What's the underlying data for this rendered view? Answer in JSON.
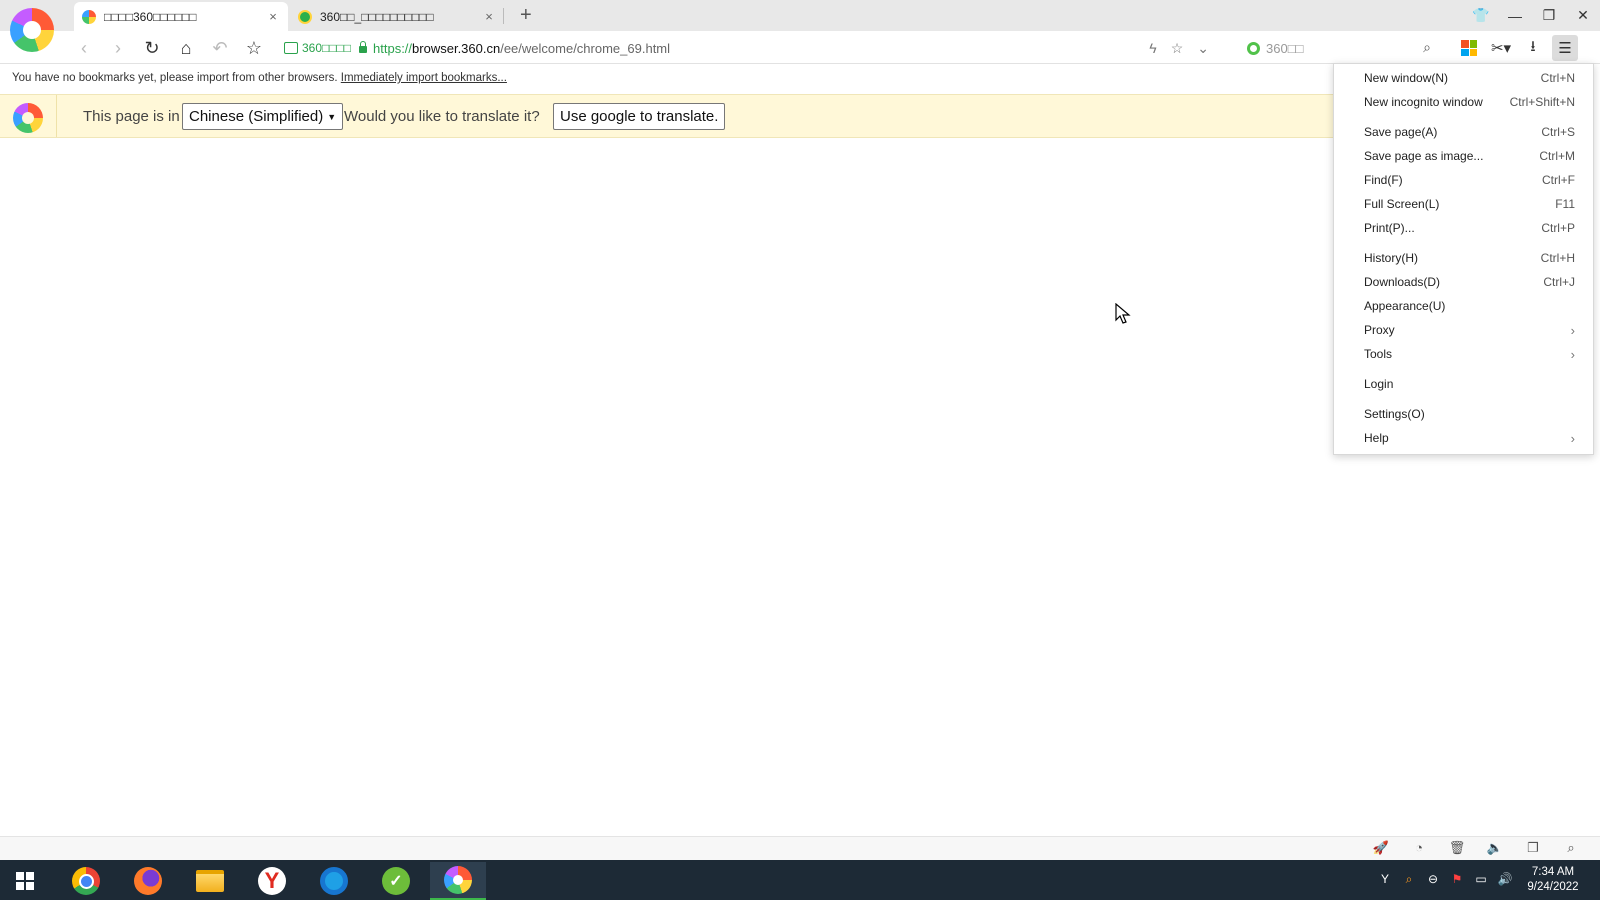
{
  "tabs": [
    {
      "label": "□□□□360□□□□□□",
      "active": true,
      "icon": "360-browser-icon"
    },
    {
      "label": "360□□_□□□□□□□□□□",
      "active": false,
      "icon": "360doc-icon"
    }
  ],
  "window": {
    "close_tab": "×",
    "new_tab": "+"
  },
  "address": {
    "cert_label": "360□□□□",
    "url_scheme": "https://",
    "url_host": "browser.360.cn",
    "url_path": "/ee/welcome/chrome_69.html"
  },
  "search": {
    "placeholder": "360□□"
  },
  "bookmarks": {
    "message": "You have no bookmarks yet, please import from other browsers.",
    "import_link": "Immediately import bookmarks..."
  },
  "translate": {
    "prefix": "This page is in",
    "language": "Chinese (Simplified)",
    "question": "Would you like to translate it?",
    "button": "Use google to translate."
  },
  "menu": {
    "items": [
      {
        "label": "New window(N)",
        "shortcut": "Ctrl+N"
      },
      {
        "label": "New incognito window",
        "shortcut": "Ctrl+Shift+N"
      },
      {
        "label": "Save page(A)",
        "shortcut": "Ctrl+S"
      },
      {
        "label": "Save page as image...",
        "shortcut": "Ctrl+M"
      },
      {
        "label": "Find(F)",
        "shortcut": "Ctrl+F"
      },
      {
        "label": "Full Screen(L)",
        "shortcut": "F11"
      },
      {
        "label": "Print(P)...",
        "shortcut": "Ctrl+P"
      },
      {
        "label": "History(H)",
        "shortcut": "Ctrl+H"
      },
      {
        "label": "Downloads(D)",
        "shortcut": "Ctrl+J"
      },
      {
        "label": "Appearance(U)",
        "shortcut": ""
      },
      {
        "label": "Proxy",
        "shortcut": "",
        "submenu": true
      },
      {
        "label": "Tools",
        "shortcut": "",
        "submenu": true
      },
      {
        "label": "Login",
        "shortcut": ""
      },
      {
        "label": "Settings(O)",
        "shortcut": ""
      },
      {
        "label": "Help",
        "shortcut": "",
        "submenu": true
      }
    ]
  },
  "taskbar": {
    "apps": [
      "chrome",
      "firefox",
      "file-explorer",
      "yandex",
      "edge",
      "360doc",
      "360-browser"
    ],
    "time": "7:34 AM",
    "date": "9/24/2022"
  },
  "colors": {
    "accent_green": "#2aa24c",
    "translate_bg": "#fff8d8",
    "taskbar_bg": "#1d2a36"
  }
}
